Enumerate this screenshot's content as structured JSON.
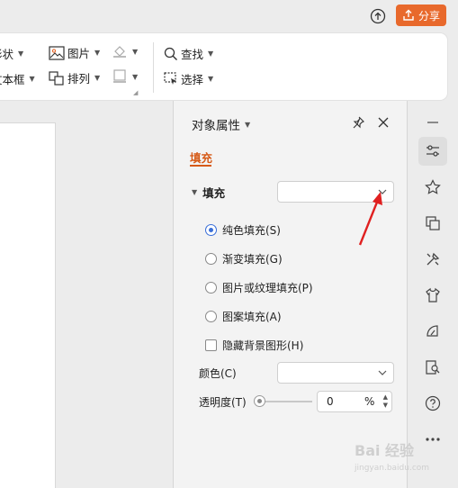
{
  "topbar": {
    "share_label": "分享"
  },
  "ribbon": {
    "shape_label": "形状",
    "textbox_label": "文本框",
    "picture_label": "图片",
    "arrange_label": "排列",
    "find_label": "查找",
    "select_label": "选择"
  },
  "panel": {
    "title": "对象属性",
    "tab_fill": "填充",
    "section_fill": "填充",
    "fill_type_value": "",
    "options": [
      {
        "label": "纯色填充(S)",
        "selected": true
      },
      {
        "label": "渐变填充(G)",
        "selected": false
      },
      {
        "label": "图片或纹理填充(P)",
        "selected": false
      },
      {
        "label": "图案填充(A)",
        "selected": false
      }
    ],
    "hide_bg_label": "隐藏背景图形(H)",
    "color_label": "颜色(C)",
    "color_value": "",
    "transparency_label": "透明度(T)",
    "transparency_value": "0",
    "transparency_unit": "%"
  },
  "watermark": {
    "text": "Bai 经验",
    "subtext": "jingyan.baidu.com"
  },
  "colors": {
    "accent": "#d65a17",
    "share": "#e8692c",
    "radio_on": "#3a6fd8",
    "arrow": "#e02020"
  }
}
